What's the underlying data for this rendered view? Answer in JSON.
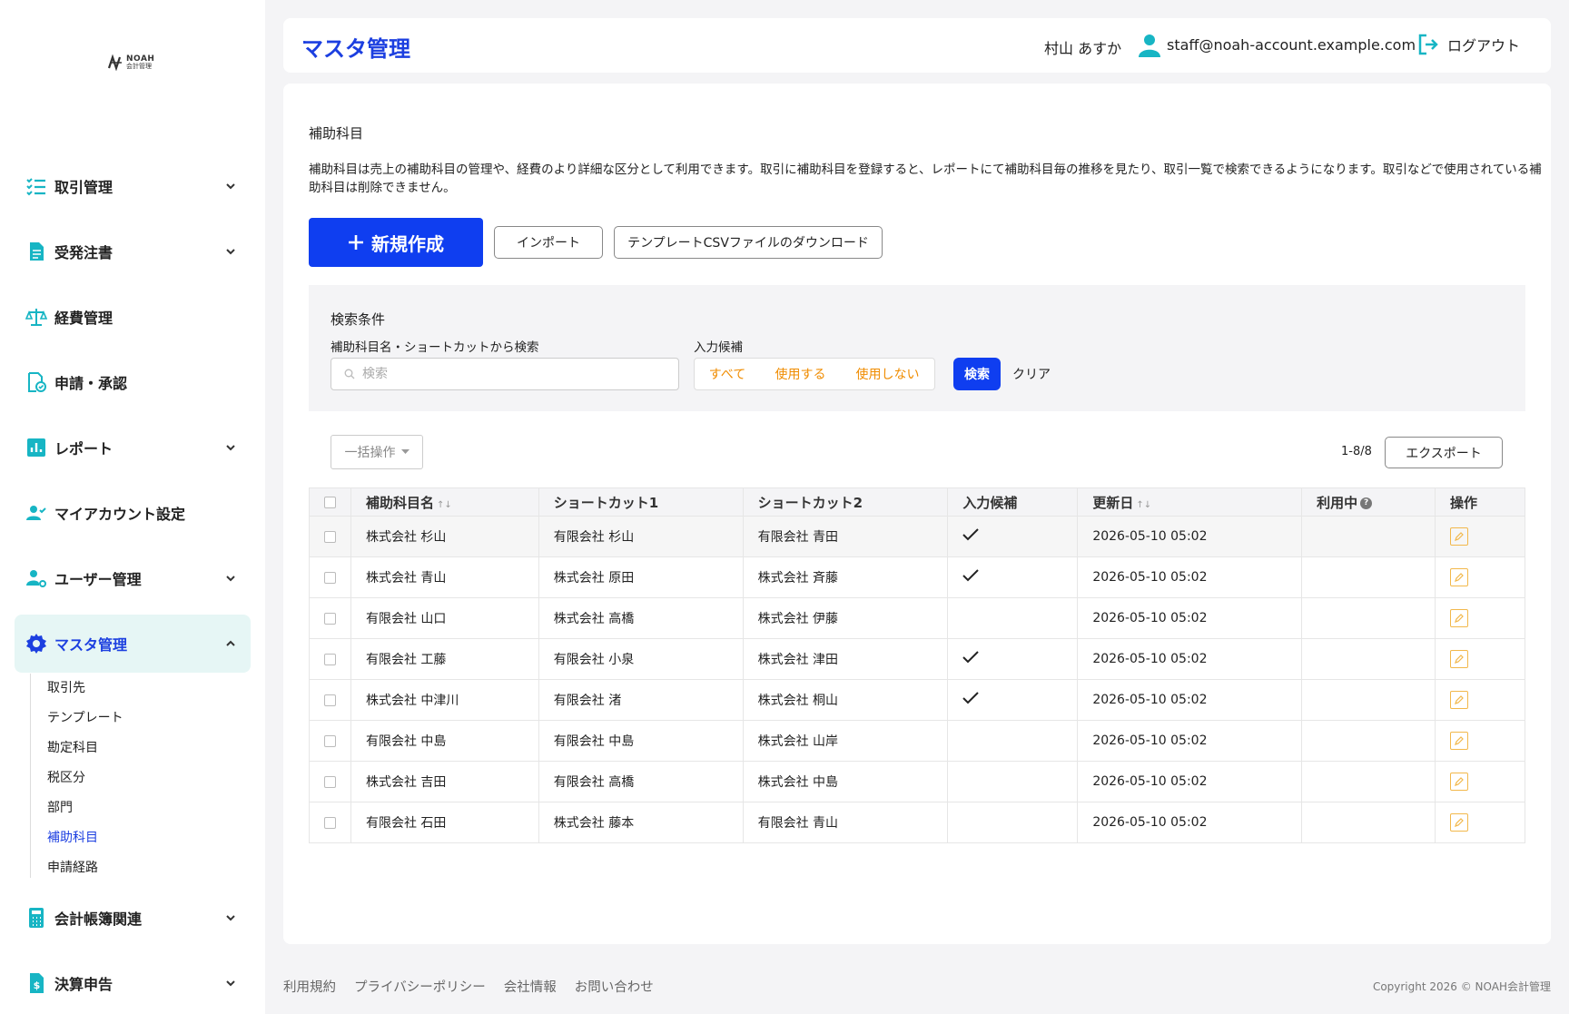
{
  "logo": {
    "line1": "NOAH",
    "line2": "会計管理"
  },
  "sidebar": {
    "items": [
      {
        "label": "取引管理",
        "icon": "checklist-icon",
        "has_chevron": true
      },
      {
        "label": "受発注書",
        "icon": "document-icon",
        "has_chevron": true
      },
      {
        "label": "経費管理",
        "icon": "scale-icon",
        "has_chevron": false
      },
      {
        "label": "申請・承認",
        "icon": "approval-icon",
        "has_chevron": false
      },
      {
        "label": "レポート",
        "icon": "bar-chart-icon",
        "has_chevron": true
      },
      {
        "label": "マイアカウント設定",
        "icon": "user-check-icon",
        "has_chevron": false
      },
      {
        "label": "ユーザー管理",
        "icon": "user-gear-icon",
        "has_chevron": true
      },
      {
        "label": "マスタ管理",
        "icon": "gear-icon",
        "has_chevron": true,
        "active": true
      },
      {
        "label": "会計帳簿関連",
        "icon": "calculator-icon",
        "has_chevron": true
      },
      {
        "label": "決算申告",
        "icon": "invoice-icon",
        "has_chevron": true
      }
    ],
    "subitems": [
      "取引先",
      "テンプレート",
      "勘定科目",
      "税区分",
      "部門",
      "補助科目",
      "申請経路"
    ],
    "current_subitem": "補助科目"
  },
  "header": {
    "title": "マスタ管理",
    "user_name": "村山 あすか",
    "email": "staff@noah-account.example.com",
    "logout": "ログアウト"
  },
  "main": {
    "section_title": "補助科目",
    "description": "補助科目は売上の補助科目の管理や、経費のより詳細な区分として利用できます。取引に補助科目を登録すると、レポートにて補助科目毎の推移を見たり、取引一覧で検索できるようになります。取引などで使用されている補助科目は削除できません。",
    "new_button": "新規作成",
    "import_button": "インポート",
    "template_button": "テンプレートCSVファイルのダウンロード",
    "search": {
      "title": "検索条件",
      "label_keyword": "補助科目名・ショートカットから検索",
      "placeholder": "検索",
      "label_candidate": "入力候補",
      "options": [
        "すべて",
        "使用する",
        "使用しない"
      ],
      "search_button": "検索",
      "clear_button": "クリア"
    },
    "bulk_action": "一括操作",
    "count": "1-8/8",
    "export_button": "エクスポート"
  },
  "table": {
    "headers": [
      "補助科目名",
      "ショートカット1",
      "ショートカット2",
      "入力候補",
      "更新日",
      "利用中",
      "操作"
    ],
    "rows": [
      {
        "name": "株式会社 杉山",
        "sc1": "有限会社 杉山",
        "sc2": "有限会社 青田",
        "candidate": true,
        "updated": "2026-05-10 05:02"
      },
      {
        "name": "株式会社 青山",
        "sc1": "株式会社 原田",
        "sc2": "株式会社 斉藤",
        "candidate": true,
        "updated": "2026-05-10 05:02"
      },
      {
        "name": "有限会社 山口",
        "sc1": "株式会社 高橋",
        "sc2": "株式会社 伊藤",
        "candidate": false,
        "updated": "2026-05-10 05:02"
      },
      {
        "name": "有限会社 工藤",
        "sc1": "有限会社 小泉",
        "sc2": "株式会社 津田",
        "candidate": true,
        "updated": "2026-05-10 05:02"
      },
      {
        "name": "株式会社 中津川",
        "sc1": "有限会社 渚",
        "sc2": "株式会社 桐山",
        "candidate": true,
        "updated": "2026-05-10 05:02"
      },
      {
        "name": "有限会社 中島",
        "sc1": "有限会社 中島",
        "sc2": "株式会社 山岸",
        "candidate": false,
        "updated": "2026-05-10 05:02"
      },
      {
        "name": "株式会社 吉田",
        "sc1": "有限会社 高橋",
        "sc2": "株式会社 中島",
        "candidate": false,
        "updated": "2026-05-10 05:02"
      },
      {
        "name": "有限会社 石田",
        "sc1": "株式会社 藤本",
        "sc2": "有限会社 青山",
        "candidate": false,
        "updated": "2026-05-10 05:02"
      }
    ]
  },
  "footer": {
    "links": [
      "利用規約",
      "プライバシーポリシー",
      "会社情報",
      "お問い合わせ"
    ],
    "copyright": "Copyright 2026 © NOAH会計管理"
  },
  "colors": {
    "primary": "#0f3ef0",
    "accent_icon": "#17b5c4",
    "option_text": "#f08c00",
    "edit_icon": "#f2b84b",
    "active_bg": "#e6f6f5"
  }
}
